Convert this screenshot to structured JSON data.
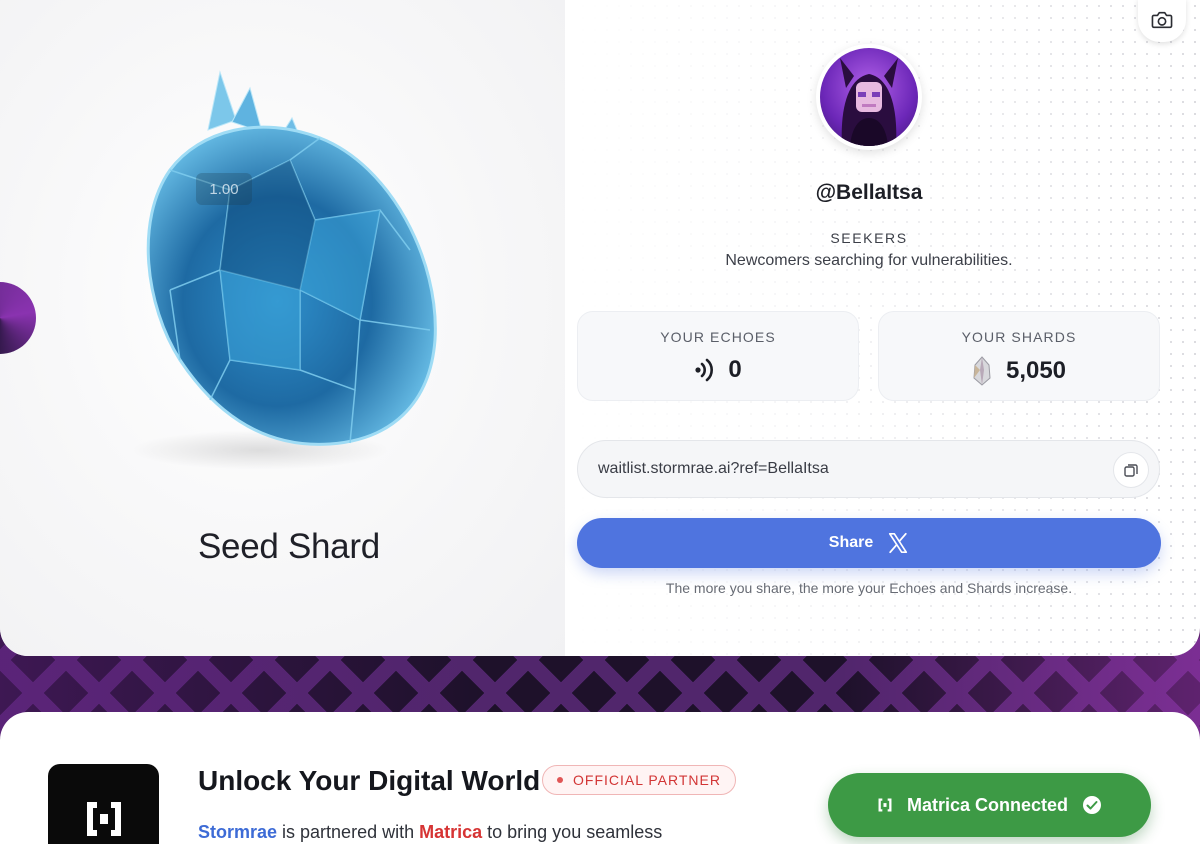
{
  "shard": {
    "name": "Seed Shard",
    "value_chip": "1.00"
  },
  "profile": {
    "username": "@BellaItsa",
    "tier": "SEEKERS",
    "tier_description": "Newcomers searching for vulnerabilities.",
    "avatar_icon": "pixel-avatar-icon"
  },
  "stats": {
    "echoes": {
      "label": "YOUR ECHOES",
      "value": "0",
      "icon": "echo-signal-icon"
    },
    "shards": {
      "label": "YOUR SHARDS",
      "value": "5,050",
      "icon": "crystal-shard-icon"
    }
  },
  "referral": {
    "link": "waitlist.stormrae.ai?ref=BellaItsa",
    "copy_icon": "copy-icon"
  },
  "share": {
    "label": "Share",
    "icon": "x-logo-icon",
    "hint": "The more you share, the more your Echoes and Shards increase."
  },
  "toolbar": {
    "camera_icon": "camera-icon"
  },
  "partner": {
    "title": "Unlock Your Digital World",
    "badge": "OFFICIAL PARTNER",
    "text_brand": "Stormrae",
    "text_mid": " is partnered with ",
    "text_partner": "Matrica",
    "text_end": " to bring you seamless",
    "connected_label": "Matrica Connected",
    "connected_icon": "check-circle-icon"
  },
  "colors": {
    "accent_blue": "#4f74df",
    "success_green": "#3d9a45",
    "partner_red": "#d23535",
    "background_purple": "#5b2a78"
  }
}
